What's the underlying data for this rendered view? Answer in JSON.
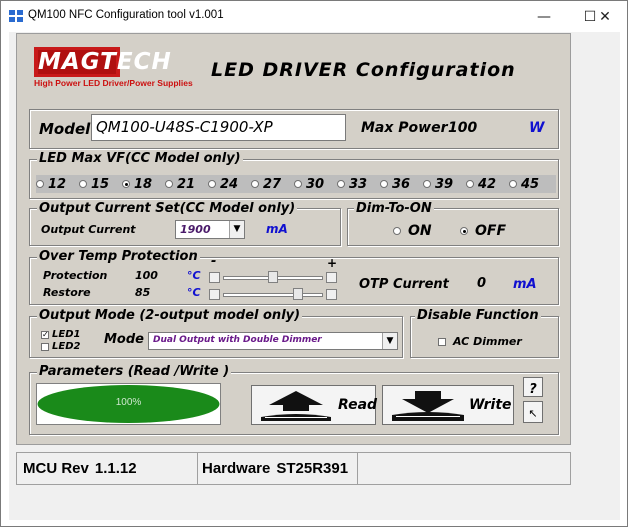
{
  "window": {
    "title": "QM100 NFC Configuration tool v1.001",
    "minimize": "—",
    "maximize": "☐",
    "close": "✕"
  },
  "logo": {
    "brand": "MAGTECH",
    "tagline": "High Power LED Driver/Power Supplies"
  },
  "heading": "LED DRIVER Configuration",
  "model": {
    "label": "Model",
    "value": "QM100-U48S-C1900-XP",
    "max_power_label": "Max Power",
    "max_power_value": "100",
    "unit": "W"
  },
  "led_vf": {
    "title": "LED Max VF(CC Model only)",
    "options": [
      "12",
      "15",
      "18",
      "21",
      "24",
      "27",
      "30",
      "33",
      "36",
      "39",
      "42",
      "45"
    ],
    "selected": "18"
  },
  "output_current": {
    "title": "Output Current Set(CC Model only)",
    "label": "Output Current",
    "value": "1900",
    "unit": "mA"
  },
  "dim_to_on": {
    "title": "Dim-To-ON",
    "on": "ON",
    "off": "OFF",
    "selected": "OFF"
  },
  "otp": {
    "title": "Over Temp Protection",
    "protection_label": "Protection",
    "protection_value": "100",
    "restore_label": "Restore",
    "restore_value": "85",
    "unit": "°C",
    "minus": "-",
    "plus": "+",
    "current_label": "OTP Current",
    "current_value": "0",
    "current_unit": "mA",
    "protection_level": 0.5,
    "restore_level": 0.78
  },
  "output_mode": {
    "title": "Output Mode (2-output model only)",
    "led1": "LED1",
    "led2": "LED2",
    "led1_checked": true,
    "led2_checked": false,
    "mode_label": "Mode",
    "mode_value": "Dual Output with Double Dimmer"
  },
  "disable": {
    "title": "Disable Function",
    "ac_dimmer": "AC Dimmer",
    "checked": false
  },
  "params": {
    "title": "Parameters (Read /Write )",
    "progress_text": "100%",
    "progress": 1.0,
    "read": "Read",
    "write": "Write",
    "help": "?",
    "pointer": "↖"
  },
  "status": {
    "mcu_label": "MCU Rev",
    "mcu_value": "1.1.12",
    "hw_label": "Hardware",
    "hw_value": "ST25R391"
  },
  "colors": {
    "panel": "#d4d0c8",
    "brand_blue": "#1640a0",
    "brand_red": "#cc1010",
    "progress_green": "#1a8a1a",
    "accent_blue": "#1010d0"
  }
}
